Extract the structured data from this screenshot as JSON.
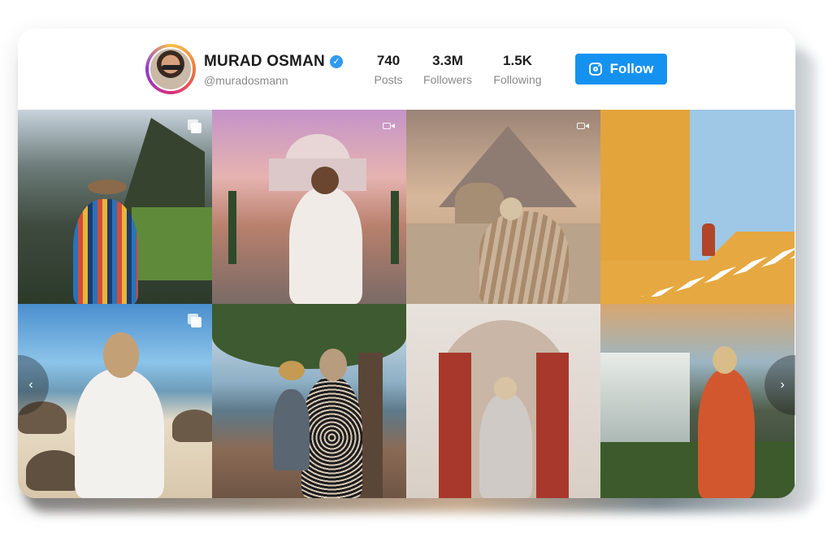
{
  "profile": {
    "name": "MURAD OSMAN",
    "handle": "@muradosmann",
    "verified": true
  },
  "stats": [
    {
      "value": "740",
      "label": "Posts"
    },
    {
      "value": "3.3M",
      "label": "Followers"
    },
    {
      "value": "1.5K",
      "label": "Following"
    }
  ],
  "follow_button": {
    "label": "Follow",
    "icon": "instagram-icon"
  },
  "colors": {
    "accent": "#1592f0",
    "verified": "#2f9bf0"
  },
  "posts": [
    {
      "scene": "machu-picchu",
      "media": "multi"
    },
    {
      "scene": "taj-mahal",
      "media": "video"
    },
    {
      "scene": "pyramid-sphinx",
      "media": "video"
    },
    {
      "scene": "yellow-stairs",
      "media": "none"
    },
    {
      "scene": "tortoise-beach",
      "media": "multi"
    },
    {
      "scene": "seaside-tree",
      "media": "none"
    },
    {
      "scene": "moroccan-arch",
      "media": "none"
    },
    {
      "scene": "waterfall",
      "media": "none"
    }
  ],
  "carousel": {
    "prev_icon": "chevron-left-icon",
    "next_icon": "chevron-right-icon"
  }
}
